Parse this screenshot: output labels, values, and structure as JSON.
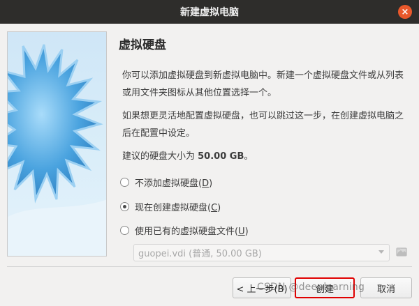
{
  "window": {
    "title": "新建虚拟电脑",
    "close_glyph": "×"
  },
  "page": {
    "title": "虚拟硬盘",
    "para1": "你可以添加虚拟硬盘到新虚拟电脑中。新建一个虚拟硬盘文件或从列表或用文件夹图标从其他位置选择一个。",
    "para2": "如果想更灵活地配置虚拟硬盘，也可以跳过这一步，在创建虚拟电脑之后在配置中设定。",
    "para3_prefix": "建议的硬盘大小为 ",
    "para3_size": "50.00 GB",
    "para3_suffix": "。"
  },
  "options": [
    {
      "label": "不添加虚拟硬盘(",
      "mnemonic": "D",
      "close": ")",
      "selected": false
    },
    {
      "label": "现在创建虚拟硬盘(",
      "mnemonic": "C",
      "close": ")",
      "selected": true
    },
    {
      "label": "使用已有的虚拟硬盘文件(",
      "mnemonic": "U",
      "close": ")",
      "selected": false
    }
  ],
  "existing_disk": {
    "value": "guopei.vdi (普通, 50.00 GB)",
    "enabled": false
  },
  "buttons": {
    "back": "< 上一步(B)",
    "create": "创建",
    "cancel": "取消"
  },
  "watermark": "CSDN @deeplearning",
  "colors": {
    "titlebar": "#2e2d2b",
    "close": "#e9582b",
    "highlight_box": "#e00000",
    "wizard_star": "#4aa3df"
  },
  "icons": {
    "close": "close-icon",
    "folder": "folder-open-icon",
    "dropdown": "chevron-down-icon"
  }
}
